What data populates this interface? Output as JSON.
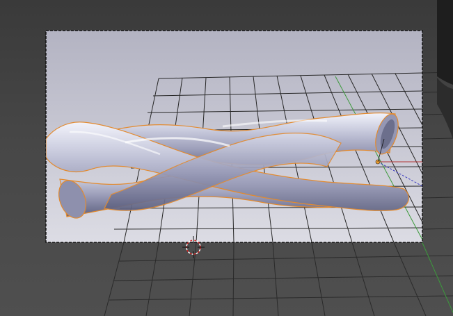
{
  "viewport": {
    "name": "3d-viewport",
    "background_top": "#3a3a3a",
    "background_bottom": "#4f4f4f"
  },
  "camera_frame": {
    "border_style": "dashed",
    "inner_fill_top": "#b3b3c2",
    "inner_fill_bottom": "#dcdce4",
    "border_color": "#111111"
  },
  "grid": {
    "line_color": "#2a2a2a",
    "inner_line_color": "#262626"
  },
  "axes": {
    "x_axis_color": "#b33535",
    "y_axis_color": "#3c9a3c",
    "z_axis_color": "#3a3ac0"
  },
  "selection": {
    "outline_color": "#e38a2e",
    "origin_color": "#f0a030"
  },
  "object": {
    "name": "twisted-rope-mesh",
    "material_color": "#a9abc4",
    "highlight_color": "#f2f3fb",
    "shadow_color": "#6c6f8c"
  },
  "cursor_3d": {
    "ring_color_a": "#d02020",
    "ring_color_b": "#ffffff"
  },
  "side_object": {
    "color": "#1e1e1e"
  }
}
